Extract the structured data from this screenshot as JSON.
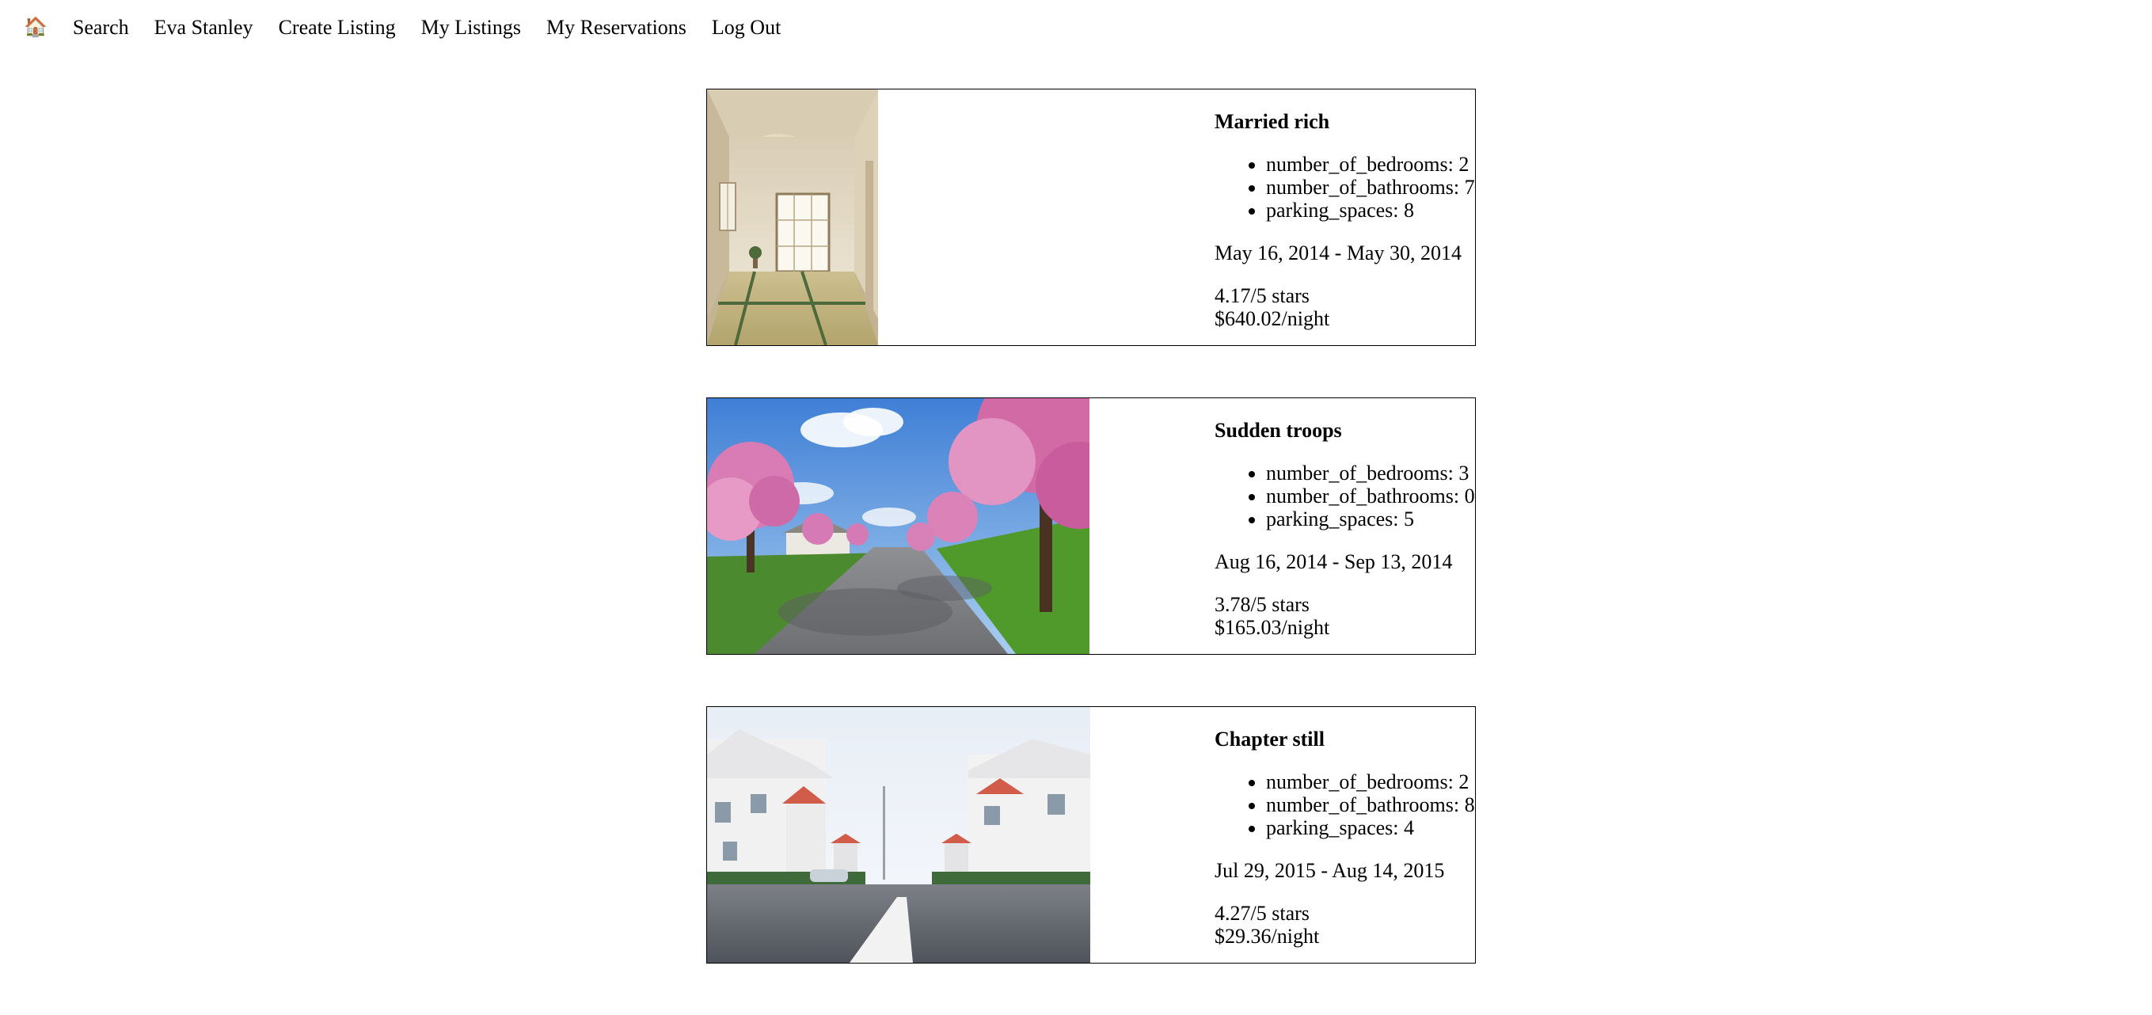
{
  "nav": {
    "home_icon": "🏠",
    "items": [
      "Search",
      "Eva Stanley",
      "Create Listing",
      "My Listings",
      "My Reservations",
      "Log Out"
    ]
  },
  "listings": [
    {
      "title": "Married rich",
      "features": [
        "number_of_bedrooms: 2",
        "number_of_bathrooms: 7",
        "parking_spaces: 8"
      ],
      "dates": "May 16, 2014 - May 30, 2014",
      "rating": "4.17/5 stars",
      "price": "$640.02/night",
      "image": "interior-room-photo"
    },
    {
      "title": "Sudden troops",
      "features": [
        "number_of_bedrooms: 3",
        "number_of_bathrooms: 0",
        "parking_spaces: 5"
      ],
      "dates": "Aug 16, 2014 - Sep 13, 2014",
      "rating": "3.78/5 stars",
      "price": "$165.03/night",
      "image": "cherry-blossom-street-photo"
    },
    {
      "title": "Chapter still",
      "features": [
        "number_of_bedrooms: 2",
        "number_of_bathrooms: 8",
        "parking_spaces: 4"
      ],
      "dates": "Jul 29, 2015 - Aug 14, 2015",
      "rating": "4.27/5 stars",
      "price": "$29.36/night",
      "image": "white-houses-street-photo"
    }
  ]
}
